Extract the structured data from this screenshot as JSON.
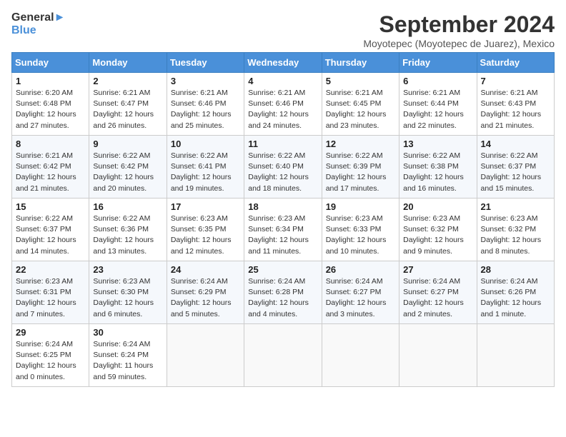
{
  "header": {
    "logo_line1": "General",
    "logo_line2": "Blue",
    "month": "September 2024",
    "location": "Moyotepec (Moyotepec de Juarez), Mexico"
  },
  "days_of_week": [
    "Sunday",
    "Monday",
    "Tuesday",
    "Wednesday",
    "Thursday",
    "Friday",
    "Saturday"
  ],
  "weeks": [
    [
      {
        "day": "1",
        "info": "Sunrise: 6:20 AM\nSunset: 6:48 PM\nDaylight: 12 hours\nand 27 minutes."
      },
      {
        "day": "2",
        "info": "Sunrise: 6:21 AM\nSunset: 6:47 PM\nDaylight: 12 hours\nand 26 minutes."
      },
      {
        "day": "3",
        "info": "Sunrise: 6:21 AM\nSunset: 6:46 PM\nDaylight: 12 hours\nand 25 minutes."
      },
      {
        "day": "4",
        "info": "Sunrise: 6:21 AM\nSunset: 6:46 PM\nDaylight: 12 hours\nand 24 minutes."
      },
      {
        "day": "5",
        "info": "Sunrise: 6:21 AM\nSunset: 6:45 PM\nDaylight: 12 hours\nand 23 minutes."
      },
      {
        "day": "6",
        "info": "Sunrise: 6:21 AM\nSunset: 6:44 PM\nDaylight: 12 hours\nand 22 minutes."
      },
      {
        "day": "7",
        "info": "Sunrise: 6:21 AM\nSunset: 6:43 PM\nDaylight: 12 hours\nand 21 minutes."
      }
    ],
    [
      {
        "day": "8",
        "info": "Sunrise: 6:21 AM\nSunset: 6:42 PM\nDaylight: 12 hours\nand 21 minutes."
      },
      {
        "day": "9",
        "info": "Sunrise: 6:22 AM\nSunset: 6:42 PM\nDaylight: 12 hours\nand 20 minutes."
      },
      {
        "day": "10",
        "info": "Sunrise: 6:22 AM\nSunset: 6:41 PM\nDaylight: 12 hours\nand 19 minutes."
      },
      {
        "day": "11",
        "info": "Sunrise: 6:22 AM\nSunset: 6:40 PM\nDaylight: 12 hours\nand 18 minutes."
      },
      {
        "day": "12",
        "info": "Sunrise: 6:22 AM\nSunset: 6:39 PM\nDaylight: 12 hours\nand 17 minutes."
      },
      {
        "day": "13",
        "info": "Sunrise: 6:22 AM\nSunset: 6:38 PM\nDaylight: 12 hours\nand 16 minutes."
      },
      {
        "day": "14",
        "info": "Sunrise: 6:22 AM\nSunset: 6:37 PM\nDaylight: 12 hours\nand 15 minutes."
      }
    ],
    [
      {
        "day": "15",
        "info": "Sunrise: 6:22 AM\nSunset: 6:37 PM\nDaylight: 12 hours\nand 14 minutes."
      },
      {
        "day": "16",
        "info": "Sunrise: 6:22 AM\nSunset: 6:36 PM\nDaylight: 12 hours\nand 13 minutes."
      },
      {
        "day": "17",
        "info": "Sunrise: 6:23 AM\nSunset: 6:35 PM\nDaylight: 12 hours\nand 12 minutes."
      },
      {
        "day": "18",
        "info": "Sunrise: 6:23 AM\nSunset: 6:34 PM\nDaylight: 12 hours\nand 11 minutes."
      },
      {
        "day": "19",
        "info": "Sunrise: 6:23 AM\nSunset: 6:33 PM\nDaylight: 12 hours\nand 10 minutes."
      },
      {
        "day": "20",
        "info": "Sunrise: 6:23 AM\nSunset: 6:32 PM\nDaylight: 12 hours\nand 9 minutes."
      },
      {
        "day": "21",
        "info": "Sunrise: 6:23 AM\nSunset: 6:32 PM\nDaylight: 12 hours\nand 8 minutes."
      }
    ],
    [
      {
        "day": "22",
        "info": "Sunrise: 6:23 AM\nSunset: 6:31 PM\nDaylight: 12 hours\nand 7 minutes."
      },
      {
        "day": "23",
        "info": "Sunrise: 6:23 AM\nSunset: 6:30 PM\nDaylight: 12 hours\nand 6 minutes."
      },
      {
        "day": "24",
        "info": "Sunrise: 6:24 AM\nSunset: 6:29 PM\nDaylight: 12 hours\nand 5 minutes."
      },
      {
        "day": "25",
        "info": "Sunrise: 6:24 AM\nSunset: 6:28 PM\nDaylight: 12 hours\nand 4 minutes."
      },
      {
        "day": "26",
        "info": "Sunrise: 6:24 AM\nSunset: 6:27 PM\nDaylight: 12 hours\nand 3 minutes."
      },
      {
        "day": "27",
        "info": "Sunrise: 6:24 AM\nSunset: 6:27 PM\nDaylight: 12 hours\nand 2 minutes."
      },
      {
        "day": "28",
        "info": "Sunrise: 6:24 AM\nSunset: 6:26 PM\nDaylight: 12 hours\nand 1 minute."
      }
    ],
    [
      {
        "day": "29",
        "info": "Sunrise: 6:24 AM\nSunset: 6:25 PM\nDaylight: 12 hours\nand 0 minutes."
      },
      {
        "day": "30",
        "info": "Sunrise: 6:24 AM\nSunset: 6:24 PM\nDaylight: 11 hours\nand 59 minutes."
      },
      {
        "day": "",
        "info": ""
      },
      {
        "day": "",
        "info": ""
      },
      {
        "day": "",
        "info": ""
      },
      {
        "day": "",
        "info": ""
      },
      {
        "day": "",
        "info": ""
      }
    ]
  ]
}
